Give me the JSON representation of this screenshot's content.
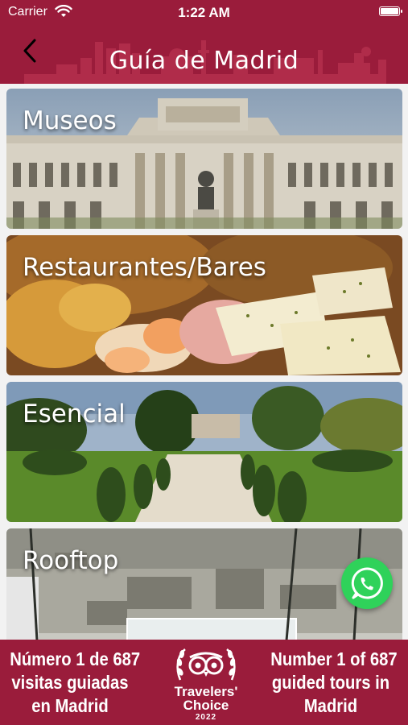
{
  "status_bar": {
    "carrier": "Carrier",
    "time": "1:22 AM"
  },
  "nav": {
    "title": "Guía de Madrid",
    "back_icon": "chevron-left-icon"
  },
  "categories": [
    {
      "label": "Museos"
    },
    {
      "label": "Restaurantes/Bares"
    },
    {
      "label": "Esencial"
    },
    {
      "label": "Rooftop"
    }
  ],
  "whatsapp": {
    "icon": "whatsapp-icon"
  },
  "footer": {
    "left_lines": [
      "Número 1 de 687",
      "visitas guiadas",
      "en Madrid"
    ],
    "badge": {
      "line1": "Travelers'",
      "line2": "Choice",
      "year": "2022"
    },
    "right_lines": [
      "Number 1 of 687",
      "guided tours in",
      "Madrid"
    ]
  },
  "colors": {
    "brand": "#9a1c3b",
    "whatsapp": "#2fd25a"
  }
}
